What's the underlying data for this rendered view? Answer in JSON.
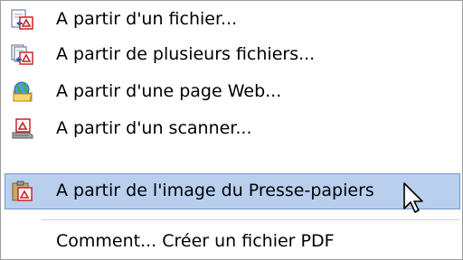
{
  "menu": {
    "items": [
      {
        "label": "A partir d'un fichier...",
        "icon": "pdf-from-file-icon"
      },
      {
        "label": "A partir de plusieurs fichiers...",
        "icon": "pdf-from-multiple-files-icon"
      },
      {
        "label": "A partir d'une page Web...",
        "icon": "globe-folder-icon"
      },
      {
        "label": "A partir d'un scanner...",
        "icon": "scanner-pdf-icon"
      },
      {
        "label": "A partir de l'image du Presse-papiers",
        "icon": "clipboard-pdf-icon",
        "highlighted": true
      },
      {
        "label": "Comment... Créer un fichier PDF"
      }
    ]
  },
  "colors": {
    "highlight_fill": "#b8cfee",
    "highlight_border": "#7296cd",
    "pdf_red": "#cc2222"
  }
}
